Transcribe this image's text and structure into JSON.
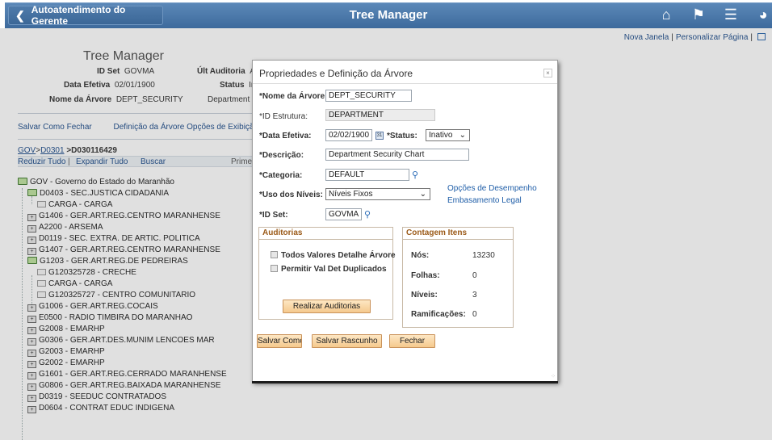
{
  "banner": {
    "back_label": "Autoatendimento do Gerente",
    "title": "Tree Manager",
    "icons": [
      "home-icon",
      "flag-icon",
      "menu-icon",
      "navbar-icon"
    ]
  },
  "toplinks": {
    "new_window": "Nova Janela",
    "personalize": "Personalizar Página"
  },
  "page": {
    "title": "Tree Manager",
    "set_id_label": "ID Set",
    "set_id_value": "GOVMA",
    "last_audit_label": "Últ Auditoria",
    "last_audit_value": "Á",
    "eff_date_label": "Data Efetiva",
    "eff_date_value": "02/01/1900",
    "status_label": "Status",
    "status_value": "In",
    "tree_name_label": "Nome da Árvore",
    "tree_name_value": "DEPT_SECURITY",
    "dept_label": "Department Se",
    "links": {
      "save_as": "Salvar Como",
      "close": "Fechar",
      "tree_def": "Definição da Árvore",
      "display_opts": "Opções de Exibiçã"
    },
    "breadcrumb": {
      "gov": "GOV",
      "sep1": ">",
      "d0301": "D0301",
      "sep2": ">D030116429"
    },
    "toolbar": {
      "collapse": "Reduzir Tudo",
      "sep": "|",
      "expand": "Expandir Tudo",
      "search": "Buscar",
      "first": "Primei"
    }
  },
  "tree": [
    {
      "label": "GOV - Governo do Estado do Maranhão",
      "icon": "open-node-icon"
    },
    {
      "label": "D0403 - SEC.JUSTICA CIDADANIA",
      "icon": "open-node-icon"
    },
    {
      "label": "CARGA - CARGA",
      "icon": "leaf-icon"
    },
    {
      "label": "G1406 - GER.ART.REG.CENTRO MARANHENSE",
      "icon": "node-icon"
    },
    {
      "label": "A2200 - ARSEMA",
      "icon": "node-icon"
    },
    {
      "label": "D0119 - SEC. EXTRA. DE ARTIC. POLITICA",
      "icon": "node-icon"
    },
    {
      "label": "G1407 - GER.ART.REG.CENTRO MARANHENSE",
      "icon": "node-icon"
    },
    {
      "label": "G1203 - GER.ART.REG.DE PEDREIRAS",
      "icon": "open-node-icon"
    },
    {
      "label": "G120325728 - CRECHE",
      "icon": "leaf-icon"
    },
    {
      "label": "CARGA - CARGA",
      "icon": "leaf-icon"
    },
    {
      "label": "G120325727 - CENTRO COMUNITARIO",
      "icon": "leaf-icon"
    },
    {
      "label": "G1006 - GER.ART.REG.COCAIS",
      "icon": "node-icon"
    },
    {
      "label": "E0500 - RADIO TIMBIRA DO MARANHAO",
      "icon": "node-icon"
    },
    {
      "label": "G2008 - EMARHP",
      "icon": "node-icon"
    },
    {
      "label": "G0306 - GER.ART.DES.MUNIM LENCOES MAR",
      "icon": "node-icon"
    },
    {
      "label": "G2003 - EMARHP",
      "icon": "node-icon"
    },
    {
      "label": "G2002 - EMARHP",
      "icon": "node-icon"
    },
    {
      "label": "G1601 - GER.ART.REG.CERRADO MARANHENSE",
      "icon": "node-icon"
    },
    {
      "label": "G0806 - GER.ART.REG.BAIXADA MARANHENSE",
      "icon": "node-icon"
    },
    {
      "label": "D0319 - SEEDUC CONTRATADOS",
      "icon": "node-icon"
    },
    {
      "label": "D0604 - CONTRAT EDUC INDIGENA",
      "icon": "node-icon"
    }
  ],
  "modal": {
    "title": "Propriedades e Definição da Árvore",
    "close_glyph": "×",
    "fields": {
      "tree_name_label": "*Nome da Árvore:",
      "tree_name_value": "DEPT_SECURITY",
      "structure_label": "*ID Estrutura:",
      "structure_value": "DEPARTMENT",
      "eff_date_label": "*Data Efetiva:",
      "eff_date_value": "02/02/1900",
      "status_label": "*Status:",
      "status_value": "Inativo",
      "desc_label": "*Descrição:",
      "desc_value": "Department Security Chart",
      "category_label": "*Categoria:",
      "category_value": "DEFAULT",
      "levels_label": "*Uso dos Níveis:",
      "levels_value": "Níveis Fixos",
      "setid_label": "*ID Set:",
      "setid_value": "GOVMA"
    },
    "links": {
      "perf_options": "Opções de Desempenho",
      "legal": "Embasamento Legal"
    },
    "audits": {
      "header": "Auditorias",
      "check1": "Todos Valores Detalhe Árvore",
      "check2": "Permitir Val Det Duplicados",
      "run_button": "Realizar Auditorias"
    },
    "counts": {
      "header": "Contagem Itens",
      "nodes_label": "Nós:",
      "nodes_value": "13230",
      "leaves_label": "Folhas:",
      "leaves_value": "0",
      "levels_label": "Níveis:",
      "levels_value": "3",
      "branches_label": "Ramificações:",
      "branches_value": "0"
    },
    "buttons": {
      "save_as": "Salvar Como",
      "save_draft": "Salvar Rascunho",
      "close": "Fechar"
    }
  },
  "colors": {
    "banner": "#4a77a8",
    "link": "#1f4e8c",
    "group_header": "#9b5a18",
    "button": "#f5c98d"
  }
}
